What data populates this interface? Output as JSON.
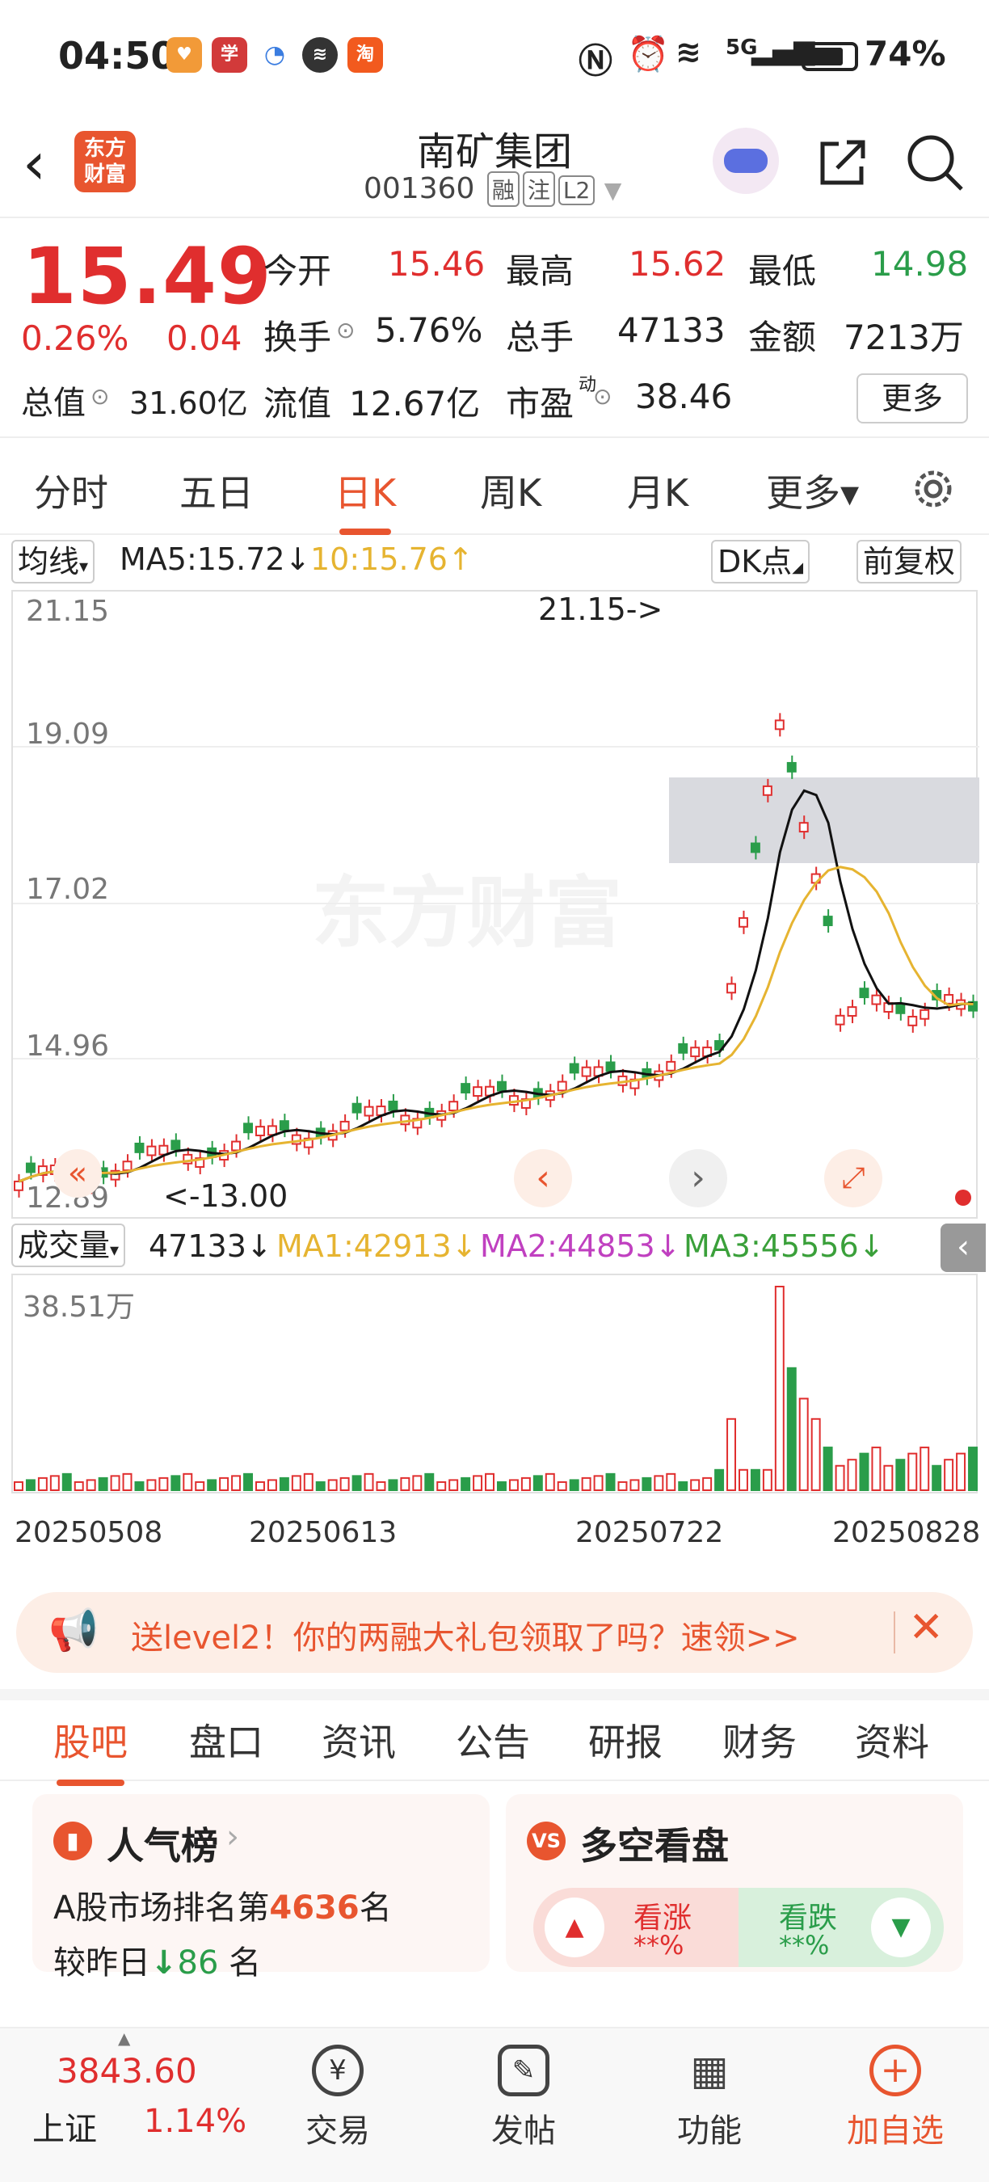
{
  "status_bar": {
    "time": "04:50",
    "network": "5G",
    "battery": "74%"
  },
  "header": {
    "back_icon": "chevron-left",
    "logo_line1": "东方",
    "logo_line2": "财富",
    "title": "南矿集团",
    "code": "001360",
    "tags": [
      "融",
      "注",
      "L2"
    ],
    "share_icon": "share-icon",
    "search_icon": "search-icon"
  },
  "quote": {
    "price": "15.49",
    "change_pct": "0.26%",
    "change": "0.04",
    "open_label": "今开",
    "open": "15.46",
    "high_label": "最高",
    "high": "15.62",
    "low_label": "最低",
    "low": "14.98",
    "turnover_label": "换手",
    "turnover": "5.76%",
    "volume_label": "总手",
    "volume": "47133",
    "amount_label": "金额",
    "amount": "7213万",
    "mktcap_label": "总值",
    "mktcap": "31.60亿",
    "float_label": "流值",
    "float_cap": "12.67亿",
    "pe_label": "市盈",
    "pe_super": "动",
    "pe": "38.46",
    "more": "更多"
  },
  "period_tabs": [
    {
      "label": "分时",
      "active": false
    },
    {
      "label": "五日",
      "active": false
    },
    {
      "label": "日K",
      "active": true
    },
    {
      "label": "周K",
      "active": false
    },
    {
      "label": "月K",
      "active": false
    },
    {
      "label": "更多▾",
      "active": false
    }
  ],
  "ma_row": {
    "selector": "均线",
    "ma5": "MA5:15.72↓",
    "ma10": "10:15.76↑",
    "dk_button": "DK点",
    "adjust_button": "前复权",
    "ma10_color": "#e6b431"
  },
  "chart_data": {
    "type": "candlestick",
    "y_ticks": [
      "21.15",
      "19.09",
      "17.02",
      "14.96",
      "12.89"
    ],
    "ylim": [
      12.89,
      21.15
    ],
    "max_annotation": "21.15->",
    "min_annotation": "<-13.00",
    "watermark": "东方财富",
    "colors": {
      "up": "#e02e2e",
      "down": "#2a9d4a",
      "ma5": "#111111",
      "ma10": "#e6b431"
    }
  },
  "volume": {
    "selector": "成交量",
    "vol": "47133↓",
    "ma1": "MA1:42913↓",
    "ma2": "MA2:44853↓",
    "ma3": "MA3:45556↓",
    "max_label": "38.51万",
    "dates": [
      "20250508",
      "20250613",
      "20250722",
      "20250828"
    ],
    "ma1_color": "#e6b431",
    "ma2_color": "#c040c0",
    "ma3_color": "#3aa03a"
  },
  "banner": {
    "text": "送level2！你的两融大礼包领取了吗？速领>>",
    "close": "✕"
  },
  "content_tabs": [
    {
      "label": "股吧",
      "active": true
    },
    {
      "label": "盘口",
      "active": false
    },
    {
      "label": "资讯",
      "active": false
    },
    {
      "label": "公告",
      "active": false
    },
    {
      "label": "研报",
      "active": false
    },
    {
      "label": "财务",
      "active": false
    },
    {
      "label": "资料",
      "active": false
    }
  ],
  "popularity": {
    "title": "人气榜",
    "rank_prefix": "A股市场排名第",
    "rank": "4636",
    "rank_suffix": "名",
    "change_prefix": "较昨日",
    "change": "86",
    "change_suffix": "名"
  },
  "long_short": {
    "title": "多空看盘",
    "up_label": "看涨",
    "up_value": "**%",
    "down_label": "看跌",
    "down_value": "**%"
  },
  "bottom_bar": {
    "index_value": "3843.60",
    "index_name": "上证",
    "index_change": "1.14%",
    "items": [
      "交易",
      "发帖",
      "功能",
      "加自选"
    ]
  }
}
